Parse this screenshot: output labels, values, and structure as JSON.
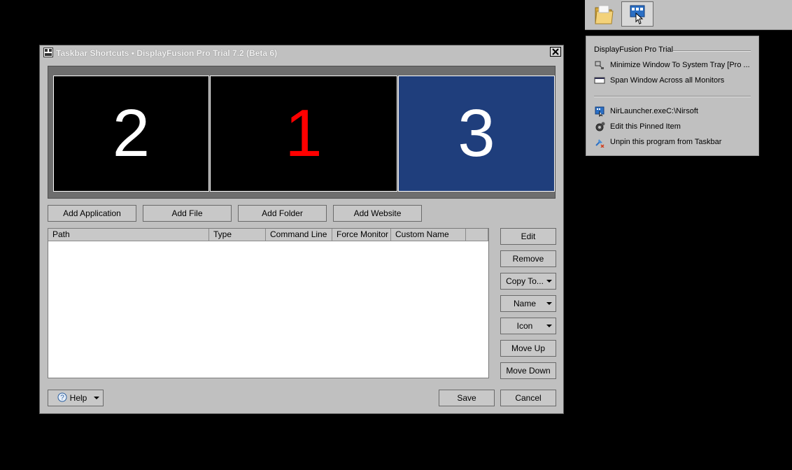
{
  "taskbar": {
    "icons": [
      "folder-icon",
      "displayfusion-icon"
    ]
  },
  "jumplist": {
    "header": "DisplayFusion Pro Trial",
    "items": [
      {
        "label": "Minimize Window To System Tray [Pro ...",
        "icon": "minimize-tray-icon"
      },
      {
        "label": "Span Window Across all Monitors",
        "icon": "span-window-icon"
      },
      {
        "label": "NirLauncher.exeC:\\Nirsoft",
        "icon": "nirlauncher-icon"
      },
      {
        "label": "Edit this Pinned Item",
        "icon": "gear-icon"
      },
      {
        "label": "Unpin this program from Taskbar",
        "icon": "unpin-icon"
      }
    ]
  },
  "dialog": {
    "title": "Taskbar Shortcuts • DisplayFusion Pro Trial 7.2 (Beta 6)",
    "monitors": [
      {
        "number": "2",
        "color": "#ffffff",
        "background": "#000000"
      },
      {
        "number": "1",
        "color": "#ff0000",
        "background": "#000000"
      },
      {
        "number": "3",
        "color": "#ffffff",
        "background": "#1f3e7c"
      }
    ],
    "add_buttons": [
      "Add Application",
      "Add File",
      "Add Folder",
      "Add Website"
    ],
    "columns": [
      "Path",
      "Type",
      "Command Line",
      "Force Monitor",
      "Custom Name"
    ],
    "side_buttons": {
      "edit": "Edit",
      "remove": "Remove",
      "copy_to": "Copy To...",
      "name": "Name",
      "icon": "Icon",
      "move_up": "Move Up",
      "move_down": "Move Down"
    },
    "help": "Help",
    "save": "Save",
    "cancel": "Cancel"
  },
  "colors": {
    "chrome": "#c0c0c0",
    "selected_monitor": "#1f3e7c",
    "primary_monitor_number": "#ff0000"
  }
}
